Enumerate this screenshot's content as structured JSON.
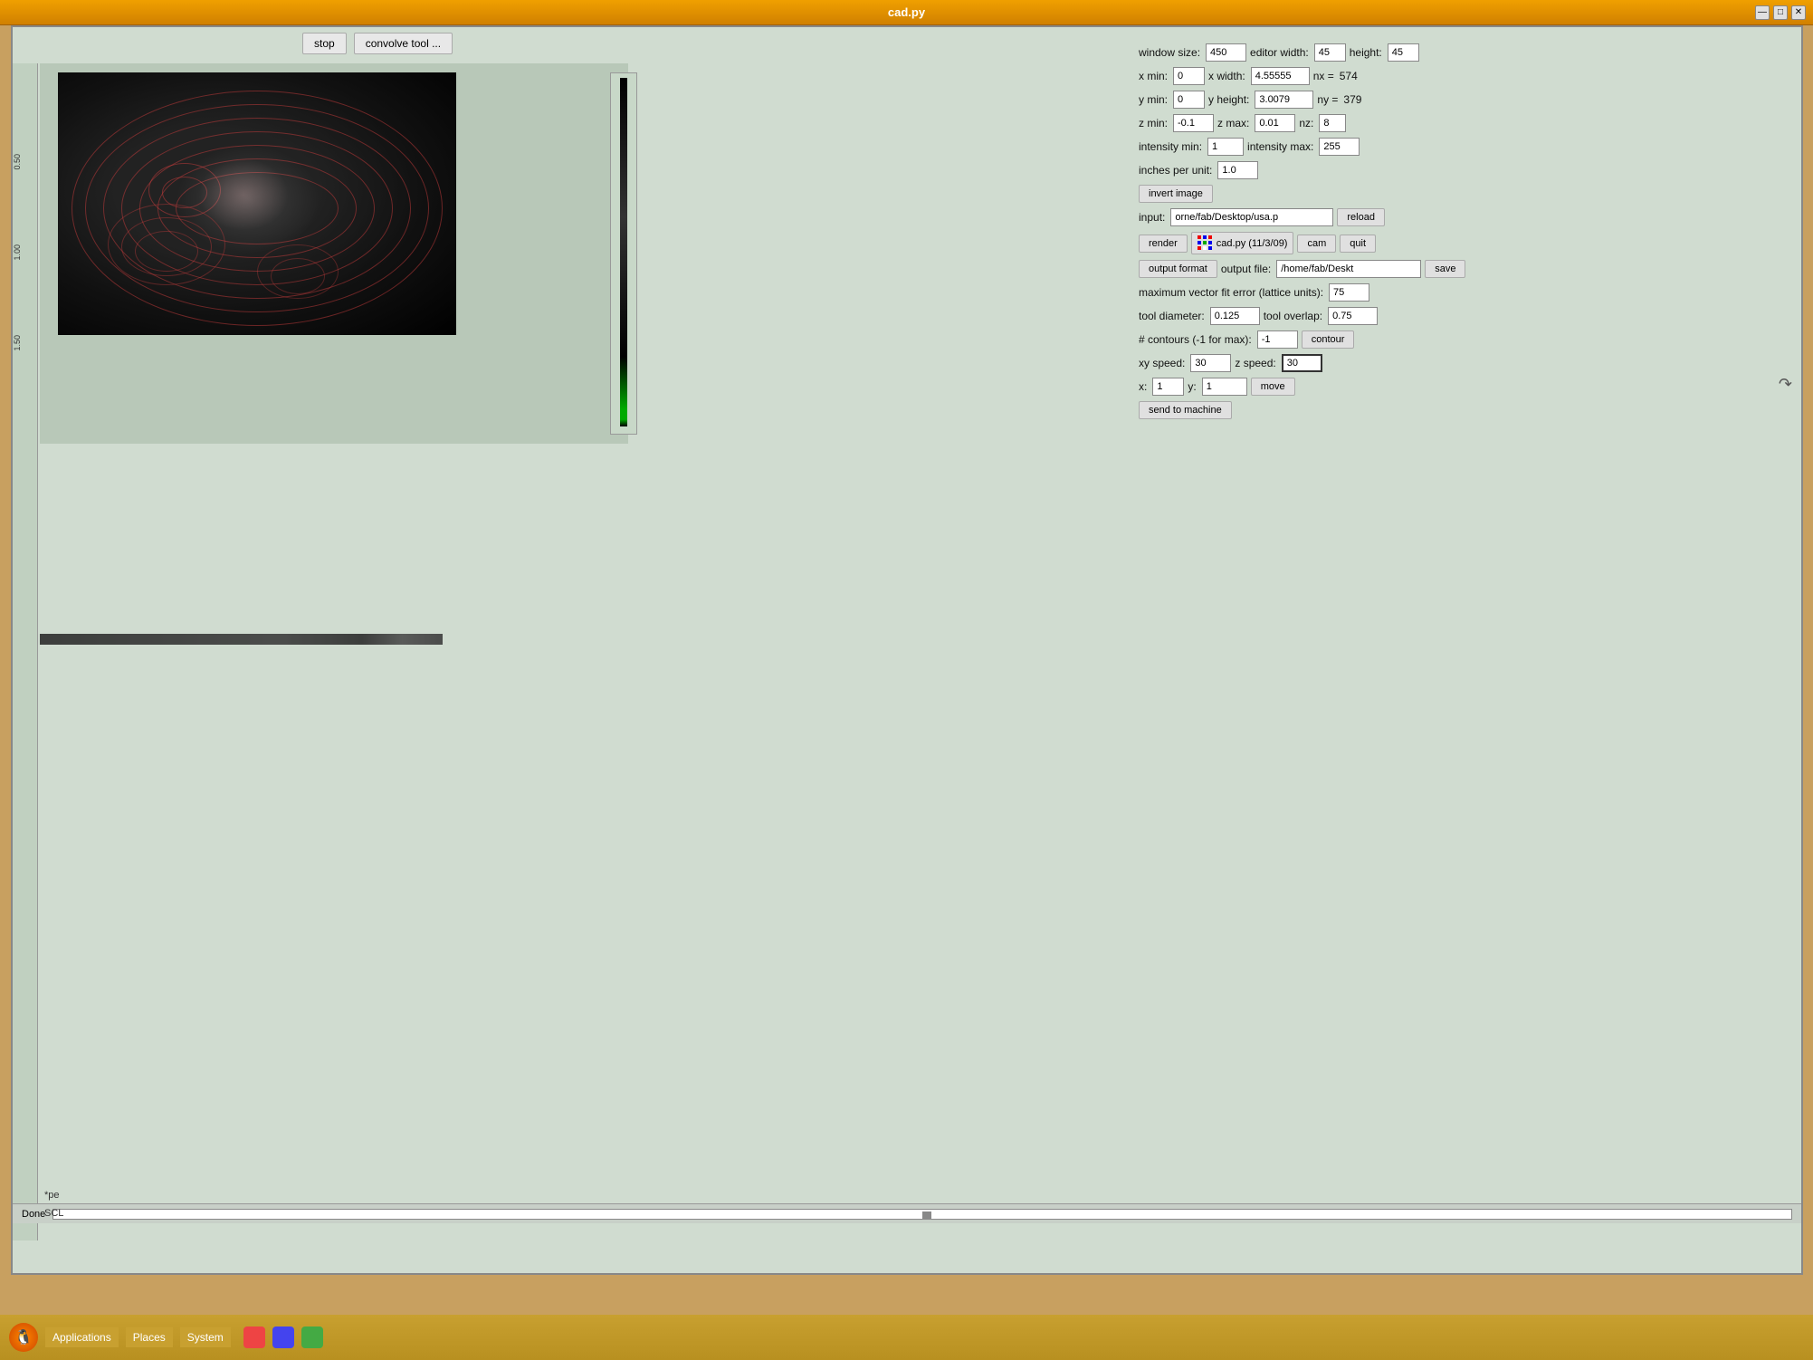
{
  "window": {
    "title": "cad.py",
    "controls": [
      "—",
      "□",
      "✕"
    ]
  },
  "toolbar": {
    "stop_label": "stop",
    "convolve_label": "convolve tool ..."
  },
  "controls": {
    "window_size_label": "window size:",
    "window_size_value": "450",
    "editor_width_label": "editor width:",
    "editor_width_value": "45",
    "height_label": "height:",
    "height_value": "45",
    "x_min_label": "x min:",
    "x_min_value": "0",
    "x_width_label": "x width:",
    "x_width_value": "4.55555",
    "nx_label": "nx =",
    "nx_value": "574",
    "y_min_label": "y min:",
    "y_min_value": "0",
    "y_height_label": "y height:",
    "y_height_value": "3.0079",
    "ny_label": "ny =",
    "ny_value": "379",
    "z_min_label": "z min:",
    "z_min_value": "-0.1",
    "z_max_label": "z max:",
    "z_max_value": "0.01",
    "nz_label": "nz:",
    "nz_value": "8",
    "intensity_min_label": "intensity min:",
    "intensity_min_value": "1",
    "intensity_max_label": "intensity max:",
    "intensity_max_value": "255",
    "inches_per_unit_label": "inches per unit:",
    "inches_per_unit_value": "1.0",
    "invert_image_label": "invert image",
    "input_label": "input:",
    "input_value": "orne/fab/Desktop/usa.p",
    "reload_label": "reload",
    "render_label": "render",
    "cad_label": "cad.py (11/3/09)",
    "cam_label": "cam",
    "quit_label": "quit",
    "output_format_label": "output format",
    "output_file_label": "output file:",
    "output_file_value": "/home/fab/Deskt",
    "save_label": "save",
    "max_vector_label": "maximum vector fit error (lattice units):",
    "max_vector_value": "75",
    "tool_diameter_label": "tool diameter:",
    "tool_diameter_value": "0.125",
    "tool_overlap_label": "tool overlap:",
    "tool_overlap_value": "0.75",
    "contours_label": "# contours (-1 for max):",
    "contours_value": "-1",
    "contour_btn_label": "contour",
    "xy_speed_label": "xy speed:",
    "xy_speed_value": "30",
    "z_speed_label": "z speed:",
    "z_speed_value": "30",
    "x_coord_label": "x:",
    "x_coord_value": "1",
    "y_coord_label": "y:",
    "y_coord_value": "1",
    "move_label": "move",
    "send_machine_label": "send to machine"
  },
  "status": {
    "text": "Done",
    "labels": [
      "*pe",
      "SCL"
    ]
  },
  "taskbar": {
    "apps_label": "Applications",
    "places_label": "Places",
    "system_label": "System"
  }
}
